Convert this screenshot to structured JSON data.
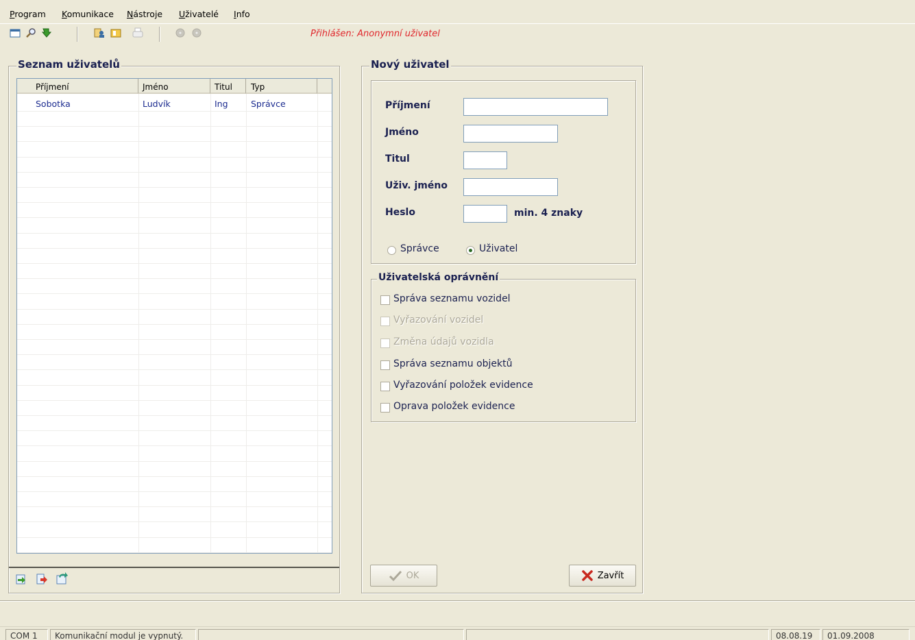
{
  "menu": {
    "items": [
      {
        "first": "P",
        "rest": "rogram"
      },
      {
        "first": "K",
        "rest": "omunikace"
      },
      {
        "first": "N",
        "rest": "ástroje"
      },
      {
        "first": "U",
        "rest": "živatelé"
      },
      {
        "first": "I",
        "rest": "nfo"
      }
    ]
  },
  "toolbar": {
    "icons": [
      "window-icon",
      "search-icon",
      "exit-icon",
      "users-icon",
      "folder-icon",
      "print-icon",
      "disc-icon",
      "disc-icon"
    ],
    "login_status": "Přihlášen: Anonymní uživatel"
  },
  "users_panel": {
    "title": "Seznam uživatelů",
    "columns": [
      "Příjmení",
      "Jméno",
      "Titul",
      "Typ"
    ],
    "rows": [
      {
        "surname": "Sobotka",
        "name": "Ludvík",
        "title": "Ing",
        "type": "Správce"
      }
    ],
    "bottom_icons": [
      "add-user-icon",
      "remove-user-icon",
      "refresh-icon"
    ]
  },
  "new_user": {
    "title": "Nový uživatel",
    "fields": {
      "surname": {
        "label": "Příjmení",
        "value": ""
      },
      "name": {
        "label": "Jméno",
        "value": ""
      },
      "title": {
        "label": "Titul",
        "value": ""
      },
      "username": {
        "label": "Uživ. jméno",
        "value": ""
      },
      "password": {
        "label": "Heslo",
        "value": "",
        "hint": "min. 4 znaky"
      }
    },
    "roles": [
      {
        "label": "Správce",
        "selected": false
      },
      {
        "label": "Uživatel",
        "selected": true
      }
    ],
    "permissions_title": "Uživatelská oprávnění",
    "permissions": [
      {
        "label": "Správa seznamu vozidel",
        "checked": false,
        "enabled": true
      },
      {
        "label": "Vyřazování vozidel",
        "checked": false,
        "enabled": false
      },
      {
        "label": "Změna údajů vozidla",
        "checked": false,
        "enabled": false
      },
      {
        "label": "Správa seznamu objektů",
        "checked": false,
        "enabled": true
      },
      {
        "label": "Vyřazování položek evidence",
        "checked": false,
        "enabled": true
      },
      {
        "label": "Oprava položek evidence",
        "checked": false,
        "enabled": true
      }
    ],
    "ok_label": "OK",
    "close_label": "Zavřít"
  },
  "statusbar": {
    "port": "COM 1",
    "message": "Komunikační modul je vypnutý.",
    "time": "08.08.19",
    "date": "01.09.2008"
  },
  "colors": {
    "accent_text": "#1a2050",
    "login_status": "#e0282d",
    "list_text": "#1b2b8f"
  }
}
